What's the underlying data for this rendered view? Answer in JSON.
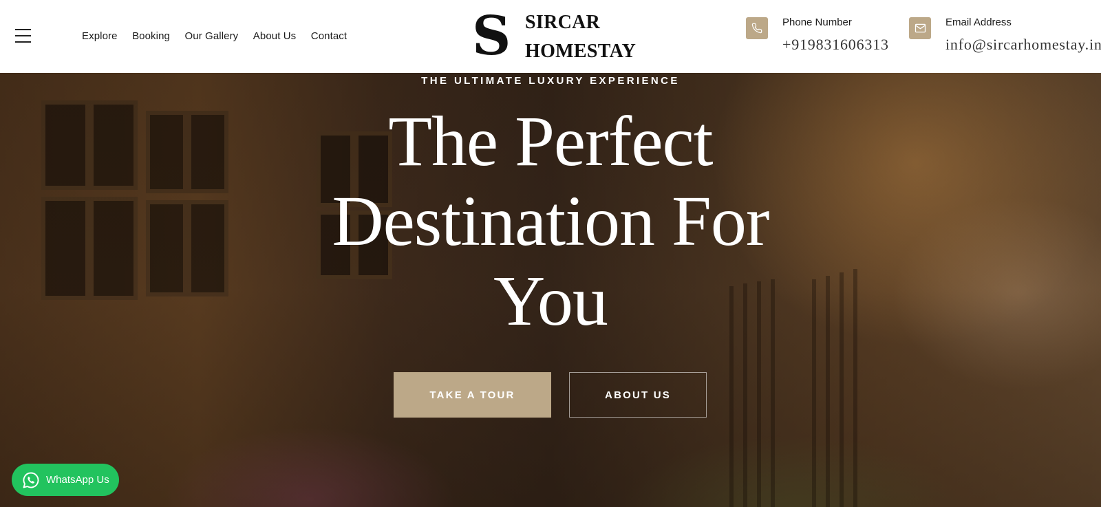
{
  "header": {
    "nav": [
      "Explore",
      "Booking",
      "Our Gallery",
      "About Us",
      "Contact"
    ],
    "logo": {
      "letter": "S",
      "line1": "SIRCAR",
      "line2": "HOMESTAY"
    },
    "phone": {
      "label": "Phone Number",
      "value": "+919831606313",
      "icon": "phone-icon"
    },
    "email": {
      "label": "Email Address",
      "value": "info@sircarhomestay.in",
      "icon": "mail-icon"
    }
  },
  "hero": {
    "kicker": "THE ULTIMATE LUXURY EXPERIENCE",
    "title_lines": [
      "The Perfect",
      "Destination For",
      "You"
    ],
    "primary_button": "TAKE A TOUR",
    "secondary_button": "ABOUT US"
  },
  "whatsapp": {
    "label": "WhatsApp Us",
    "icon": "whatsapp-icon"
  },
  "colors": {
    "accent": "#bca888",
    "whatsapp": "#22c35e",
    "header_bg": "#ffffff"
  }
}
